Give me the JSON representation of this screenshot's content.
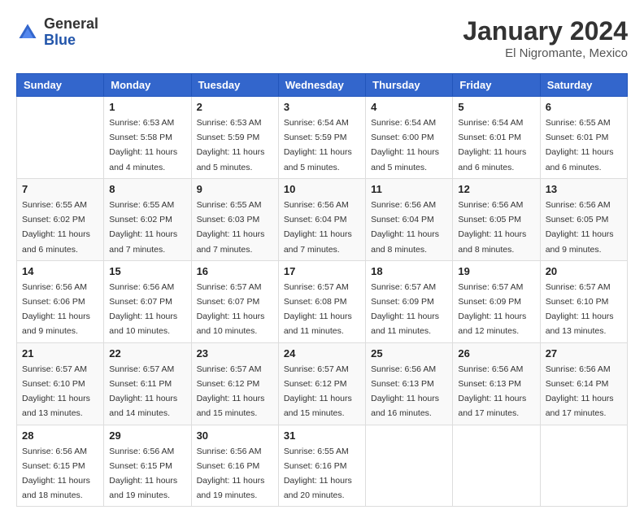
{
  "logo": {
    "general": "General",
    "blue": "Blue"
  },
  "title": {
    "month": "January 2024",
    "location": "El Nigromante, Mexico"
  },
  "weekdays": [
    "Sunday",
    "Monday",
    "Tuesday",
    "Wednesday",
    "Thursday",
    "Friday",
    "Saturday"
  ],
  "weeks": [
    [
      {
        "day": "",
        "sunrise": "",
        "sunset": "",
        "daylight": ""
      },
      {
        "day": "1",
        "sunrise": "Sunrise: 6:53 AM",
        "sunset": "Sunset: 5:58 PM",
        "daylight": "Daylight: 11 hours and 4 minutes."
      },
      {
        "day": "2",
        "sunrise": "Sunrise: 6:53 AM",
        "sunset": "Sunset: 5:59 PM",
        "daylight": "Daylight: 11 hours and 5 minutes."
      },
      {
        "day": "3",
        "sunrise": "Sunrise: 6:54 AM",
        "sunset": "Sunset: 5:59 PM",
        "daylight": "Daylight: 11 hours and 5 minutes."
      },
      {
        "day": "4",
        "sunrise": "Sunrise: 6:54 AM",
        "sunset": "Sunset: 6:00 PM",
        "daylight": "Daylight: 11 hours and 5 minutes."
      },
      {
        "day": "5",
        "sunrise": "Sunrise: 6:54 AM",
        "sunset": "Sunset: 6:01 PM",
        "daylight": "Daylight: 11 hours and 6 minutes."
      },
      {
        "day": "6",
        "sunrise": "Sunrise: 6:55 AM",
        "sunset": "Sunset: 6:01 PM",
        "daylight": "Daylight: 11 hours and 6 minutes."
      }
    ],
    [
      {
        "day": "7",
        "sunrise": "Sunrise: 6:55 AM",
        "sunset": "Sunset: 6:02 PM",
        "daylight": "Daylight: 11 hours and 6 minutes."
      },
      {
        "day": "8",
        "sunrise": "Sunrise: 6:55 AM",
        "sunset": "Sunset: 6:02 PM",
        "daylight": "Daylight: 11 hours and 7 minutes."
      },
      {
        "day": "9",
        "sunrise": "Sunrise: 6:55 AM",
        "sunset": "Sunset: 6:03 PM",
        "daylight": "Daylight: 11 hours and 7 minutes."
      },
      {
        "day": "10",
        "sunrise": "Sunrise: 6:56 AM",
        "sunset": "Sunset: 6:04 PM",
        "daylight": "Daylight: 11 hours and 7 minutes."
      },
      {
        "day": "11",
        "sunrise": "Sunrise: 6:56 AM",
        "sunset": "Sunset: 6:04 PM",
        "daylight": "Daylight: 11 hours and 8 minutes."
      },
      {
        "day": "12",
        "sunrise": "Sunrise: 6:56 AM",
        "sunset": "Sunset: 6:05 PM",
        "daylight": "Daylight: 11 hours and 8 minutes."
      },
      {
        "day": "13",
        "sunrise": "Sunrise: 6:56 AM",
        "sunset": "Sunset: 6:05 PM",
        "daylight": "Daylight: 11 hours and 9 minutes."
      }
    ],
    [
      {
        "day": "14",
        "sunrise": "Sunrise: 6:56 AM",
        "sunset": "Sunset: 6:06 PM",
        "daylight": "Daylight: 11 hours and 9 minutes."
      },
      {
        "day": "15",
        "sunrise": "Sunrise: 6:56 AM",
        "sunset": "Sunset: 6:07 PM",
        "daylight": "Daylight: 11 hours and 10 minutes."
      },
      {
        "day": "16",
        "sunrise": "Sunrise: 6:57 AM",
        "sunset": "Sunset: 6:07 PM",
        "daylight": "Daylight: 11 hours and 10 minutes."
      },
      {
        "day": "17",
        "sunrise": "Sunrise: 6:57 AM",
        "sunset": "Sunset: 6:08 PM",
        "daylight": "Daylight: 11 hours and 11 minutes."
      },
      {
        "day": "18",
        "sunrise": "Sunrise: 6:57 AM",
        "sunset": "Sunset: 6:09 PM",
        "daylight": "Daylight: 11 hours and 11 minutes."
      },
      {
        "day": "19",
        "sunrise": "Sunrise: 6:57 AM",
        "sunset": "Sunset: 6:09 PM",
        "daylight": "Daylight: 11 hours and 12 minutes."
      },
      {
        "day": "20",
        "sunrise": "Sunrise: 6:57 AM",
        "sunset": "Sunset: 6:10 PM",
        "daylight": "Daylight: 11 hours and 13 minutes."
      }
    ],
    [
      {
        "day": "21",
        "sunrise": "Sunrise: 6:57 AM",
        "sunset": "Sunset: 6:10 PM",
        "daylight": "Daylight: 11 hours and 13 minutes."
      },
      {
        "day": "22",
        "sunrise": "Sunrise: 6:57 AM",
        "sunset": "Sunset: 6:11 PM",
        "daylight": "Daylight: 11 hours and 14 minutes."
      },
      {
        "day": "23",
        "sunrise": "Sunrise: 6:57 AM",
        "sunset": "Sunset: 6:12 PM",
        "daylight": "Daylight: 11 hours and 15 minutes."
      },
      {
        "day": "24",
        "sunrise": "Sunrise: 6:57 AM",
        "sunset": "Sunset: 6:12 PM",
        "daylight": "Daylight: 11 hours and 15 minutes."
      },
      {
        "day": "25",
        "sunrise": "Sunrise: 6:56 AM",
        "sunset": "Sunset: 6:13 PM",
        "daylight": "Daylight: 11 hours and 16 minutes."
      },
      {
        "day": "26",
        "sunrise": "Sunrise: 6:56 AM",
        "sunset": "Sunset: 6:13 PM",
        "daylight": "Daylight: 11 hours and 17 minutes."
      },
      {
        "day": "27",
        "sunrise": "Sunrise: 6:56 AM",
        "sunset": "Sunset: 6:14 PM",
        "daylight": "Daylight: 11 hours and 17 minutes."
      }
    ],
    [
      {
        "day": "28",
        "sunrise": "Sunrise: 6:56 AM",
        "sunset": "Sunset: 6:15 PM",
        "daylight": "Daylight: 11 hours and 18 minutes."
      },
      {
        "day": "29",
        "sunrise": "Sunrise: 6:56 AM",
        "sunset": "Sunset: 6:15 PM",
        "daylight": "Daylight: 11 hours and 19 minutes."
      },
      {
        "day": "30",
        "sunrise": "Sunrise: 6:56 AM",
        "sunset": "Sunset: 6:16 PM",
        "daylight": "Daylight: 11 hours and 19 minutes."
      },
      {
        "day": "31",
        "sunrise": "Sunrise: 6:55 AM",
        "sunset": "Sunset: 6:16 PM",
        "daylight": "Daylight: 11 hours and 20 minutes."
      },
      {
        "day": "",
        "sunrise": "",
        "sunset": "",
        "daylight": ""
      },
      {
        "day": "",
        "sunrise": "",
        "sunset": "",
        "daylight": ""
      },
      {
        "day": "",
        "sunrise": "",
        "sunset": "",
        "daylight": ""
      }
    ]
  ]
}
